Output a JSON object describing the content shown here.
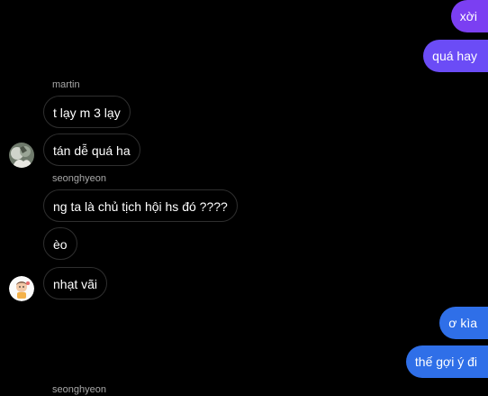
{
  "colors": {
    "background": "#000000",
    "outgoing_purple": "#7b3ff2",
    "outgoing_violet": "#6b4cf6",
    "outgoing_blue": "#2f6fe8",
    "incoming_border": "#2f2f2f",
    "sender_name": "#a8a8a8"
  },
  "messages": {
    "out_1": "xời",
    "out_2": "quá hay",
    "group_1": {
      "sender": "martin",
      "msg_1": "t lạy m 3 lạy",
      "msg_2": "tán dễ quá ha"
    },
    "group_2": {
      "sender": "seonghyeon",
      "msg_1": "ng ta là chủ tịch hội hs đó ????",
      "msg_2": "èo",
      "msg_3": "nhạt vãi"
    },
    "out_3": "ơ kìa",
    "out_4": "thế gợi ý đi",
    "group_3": {
      "sender": "seonghyeon"
    }
  },
  "icons": {
    "avatar_martin": "avatar-photo-icon",
    "avatar_seonghyeon": "avatar-cartoon-icon"
  }
}
